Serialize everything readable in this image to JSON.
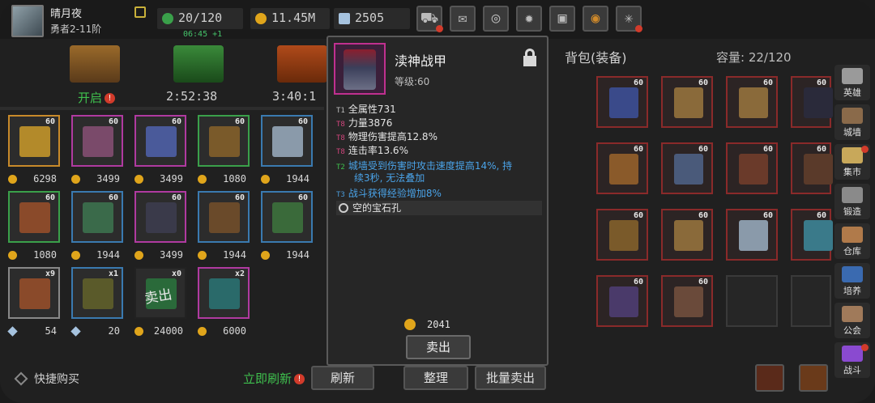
{
  "player": {
    "name": "晴月夜",
    "rank": "勇者2-11阶"
  },
  "stats": {
    "energy": "20/120",
    "timer": "06:45 +1",
    "gold": "11.45M",
    "gems": "2505"
  },
  "chests": [
    {
      "label": "开启",
      "color": "#7a4a1e"
    },
    {
      "label": "2:52:38",
      "color": "#2e6b2a"
    },
    {
      "label": "3:40:1",
      "color": "#8a3a1a"
    }
  ],
  "shop_items": [
    {
      "level": "60",
      "price": "6298",
      "border": "#c88a2a",
      "art": "#b38a2a",
      "cur": "coin"
    },
    {
      "level": "60",
      "price": "3499",
      "border": "#b03aa0",
      "art": "#7a4a6a",
      "cur": "coin"
    },
    {
      "level": "60",
      "price": "3499",
      "border": "#b03aa0",
      "art": "#4a5a9a",
      "cur": "coin"
    },
    {
      "level": "60",
      "price": "1080",
      "border": "#3aa04a",
      "art": "#7a5a2a",
      "cur": "coin"
    },
    {
      "level": "60",
      "price": "1944",
      "border": "#3a7ab0",
      "art": "#8a9aaa",
      "cur": "coin"
    },
    {
      "level": "60",
      "price": "1080",
      "border": "#3aa04a",
      "art": "#8a4a2a",
      "cur": "coin"
    },
    {
      "level": "60",
      "price": "1944",
      "border": "#3a7ab0",
      "art": "#3a6a4a",
      "cur": "coin"
    },
    {
      "level": "60",
      "price": "3499",
      "border": "#b03aa0",
      "art": "#3a3a4a",
      "cur": "coin"
    },
    {
      "level": "60",
      "price": "1944",
      "border": "#3a7ab0",
      "art": "#6a4a2a",
      "cur": "coin"
    },
    {
      "level": "60",
      "price": "1944",
      "border": "#3a7ab0",
      "art": "#3a6a3a",
      "cur": "coin"
    },
    {
      "level": "x9",
      "price": "54",
      "border": "#888888",
      "art": "#8a4a2a",
      "cur": "gem"
    },
    {
      "level": "x1",
      "price": "20",
      "border": "#3a7ab0",
      "art": "#5a5a2a",
      "cur": "gem"
    },
    {
      "level": "x0",
      "price": "24000",
      "border": "#222222",
      "art": "#2a6a3a",
      "cur": "coin"
    },
    {
      "level": "x2",
      "price": "6000",
      "border": "#b03aa0",
      "art": "#2a6a6a",
      "cur": "coin"
    }
  ],
  "sold_label": "卖出",
  "bag": {
    "title": "背包(装备)",
    "capacity": "容量:  22/120",
    "items": [
      {
        "level": "60",
        "art": "#3a4a8a"
      },
      {
        "level": "60",
        "art": "#8a6a3a"
      },
      {
        "level": "60",
        "art": "#8a6a3a"
      },
      {
        "level": "60",
        "art": "#2a2a3a"
      },
      {
        "level": "60",
        "art": "#8a5a2a"
      },
      {
        "level": "60",
        "art": "#4a5a7a"
      },
      {
        "level": "60",
        "art": "#6a3a2a"
      },
      {
        "level": "60",
        "art": "#5a3a2a"
      },
      {
        "level": "60",
        "art": "#7a5a2a"
      },
      {
        "level": "60",
        "art": "#8a6a3a"
      },
      {
        "level": "60",
        "art": "#8a9aaa"
      },
      {
        "level": "60",
        "art": "#3a7a8a"
      },
      {
        "level": "60",
        "art": "#4a3a6a"
      },
      {
        "level": "60",
        "art": "#6a4a3a"
      },
      {
        "level": "",
        "art": ""
      },
      {
        "level": "",
        "art": ""
      }
    ]
  },
  "side_menu": [
    {
      "label": "英雄",
      "color": "#9a9a9a"
    },
    {
      "label": "城墙",
      "color": "#8a6a4a"
    },
    {
      "label": "集市",
      "color": "#c8a85a"
    },
    {
      "label": "锻造",
      "color": "#8a8a8a"
    },
    {
      "label": "仓库",
      "color": "#b07a4a"
    },
    {
      "label": "培养",
      "color": "#3a6ab0"
    },
    {
      "label": "公会",
      "color": "#a07a5a"
    },
    {
      "label": "战斗",
      "color": "#8a4ad0"
    }
  ],
  "bottom": {
    "quick_buy": "快捷购买",
    "refresh_now": "立即刷新",
    "refresh": "刷新",
    "sort": "整理",
    "batch_sell": "批量卖出"
  },
  "tooltip": {
    "name": "渎神战甲",
    "level": "等级:60",
    "attrs": [
      {
        "tier": "T1",
        "text": "全属性731"
      },
      {
        "tier": "T8",
        "text": "力量3876"
      },
      {
        "tier": "T8",
        "text": "物理伤害提高12.8%"
      },
      {
        "tier": "T8",
        "text": "连击率13.6%"
      }
    ],
    "special": {
      "tier": "T2",
      "line1": "城墙受到伤害时攻击速度提高14%, 持",
      "line2": "续3秒, 无法叠加"
    },
    "special2": {
      "tier": "T3",
      "text": "战斗获得经验增加8%"
    },
    "gem_slot": "空的宝石孔",
    "price": "2041",
    "sell": "卖出"
  }
}
